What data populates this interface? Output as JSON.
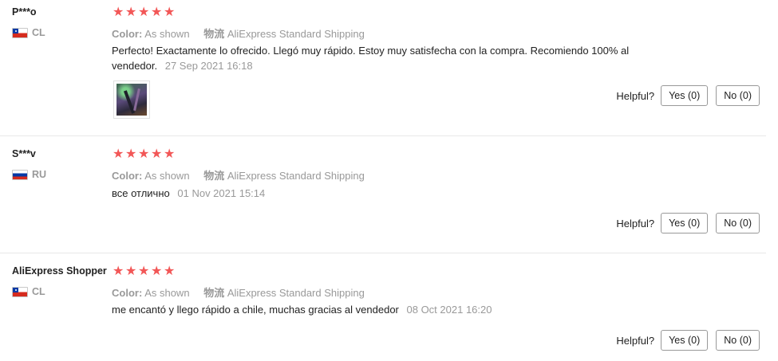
{
  "reviews": [
    {
      "user_name": "P***o",
      "country_code": "CL",
      "rating": 5,
      "color_label": "Color:",
      "color_value": "As shown",
      "shipping_label": "物流",
      "shipping_value": "AliExpress Standard Shipping",
      "comment": "Perfecto! Exactamente lo ofrecido. Llegó muy rápido. Estoy muy satisfecha con la compra. Recomiendo 100% al vendedor.",
      "date": "27 Sep 2021 16:18",
      "has_photo": true,
      "helpful_label": "Helpful?",
      "yes_label": "Yes (0)",
      "no_label": "No (0)"
    },
    {
      "user_name": "S***v",
      "country_code": "RU",
      "rating": 5,
      "color_label": "Color:",
      "color_value": "As shown",
      "shipping_label": "物流",
      "shipping_value": "AliExpress Standard Shipping",
      "comment": "все отлично",
      "date": "01 Nov 2021 15:14",
      "has_photo": false,
      "helpful_label": "Helpful?",
      "yes_label": "Yes (0)",
      "no_label": "No (0)"
    },
    {
      "user_name": "AliExpress Shopper",
      "country_code": "CL",
      "rating": 5,
      "color_label": "Color:",
      "color_value": "As shown",
      "shipping_label": "物流",
      "shipping_value": "AliExpress Standard Shipping",
      "comment": "me encantó y llego rápido a chile, muchas gracias al vendedor",
      "date": "08 Oct 2021 16:20",
      "has_photo": false,
      "helpful_label": "Helpful?",
      "yes_label": "Yes (0)",
      "no_label": "No (0)"
    }
  ],
  "colors": {
    "star": "#f25757",
    "muted_text": "#999999",
    "divider": "#e8e8e8"
  }
}
